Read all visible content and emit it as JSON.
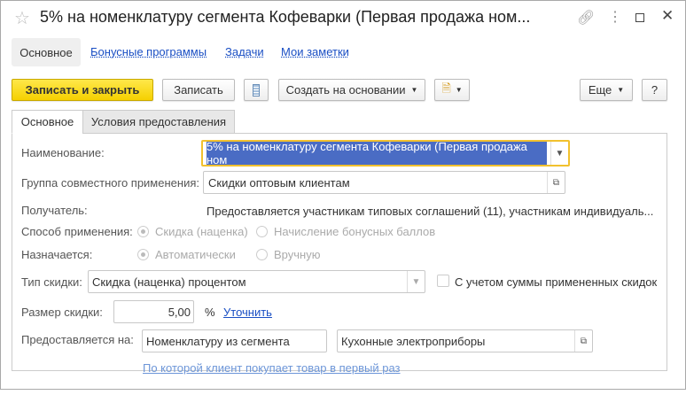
{
  "window": {
    "title": "5% на номенклатуру сегмента Кофеварки (Первая продажа ном..."
  },
  "nav": {
    "items": [
      "Основное",
      "Бонусные программы",
      "Задачи",
      "Мои заметки"
    ]
  },
  "toolbar": {
    "save_close": "Записать и закрыть",
    "save": "Записать",
    "create_based": "Создать на основании",
    "more": "Еще",
    "help": "?"
  },
  "tabs": [
    "Основное",
    "Условия предоставления"
  ],
  "form": {
    "name_label": "Наименование:",
    "name_value": "5% на номенклатуру сегмента Кофеварки (Первая продажа ном",
    "group_label": "Группа совместного применения:",
    "group_value": "Скидки оптовым клиентам",
    "recipient_label": "Получатель:",
    "recipient_value": "Предоставляется участникам типовых соглашений (11), участникам индивидуаль...",
    "method_label": "Способ применения:",
    "method_options": [
      "Скидка (наценка)",
      "Начисление бонусных баллов"
    ],
    "assign_label": "Назначается:",
    "assign_options": [
      "Автоматически",
      "Вручную"
    ],
    "type_label": "Тип скидки:",
    "type_value": "Скидка (наценка) процентом",
    "consider_label": "С учетом суммы примененных скидок",
    "size_label": "Размер скидки:",
    "size_value": "5,00",
    "size_unit": "%",
    "refine_link": "Уточнить",
    "provided_label": "Предоставляется на:",
    "provided_value": "Номенклатуру из сегмента",
    "segment_value": "Кухонные электроприборы",
    "condition_link": "По которой клиент покупает товар в первый раз"
  }
}
